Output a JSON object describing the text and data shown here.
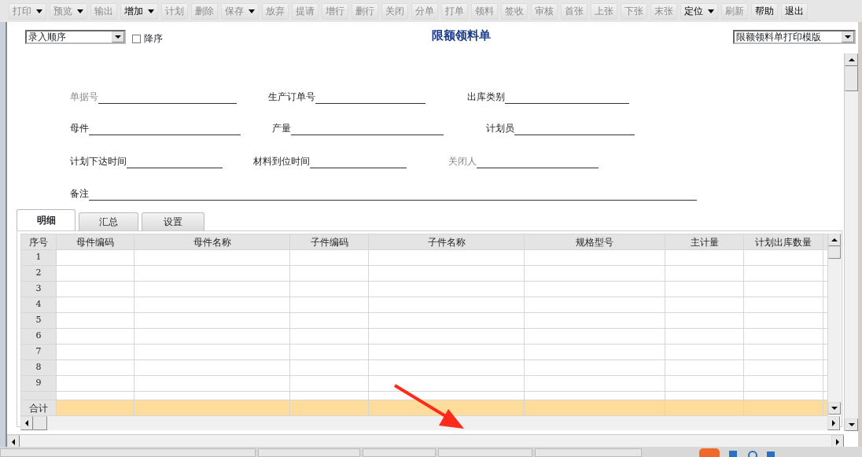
{
  "toolbar": [
    {
      "label": "打印",
      "enabled": false,
      "dropdown": true
    },
    {
      "label": "预览",
      "enabled": false,
      "dropdown": true
    },
    {
      "label": "输出",
      "enabled": false,
      "dropdown": false
    },
    {
      "label": "增加",
      "enabled": true,
      "dropdown": true
    },
    {
      "label": "计划",
      "enabled": false,
      "dropdown": false
    },
    {
      "label": "删除",
      "enabled": false,
      "dropdown": false
    },
    {
      "label": "保存",
      "enabled": false,
      "dropdown": true
    },
    {
      "label": "放弃",
      "enabled": false,
      "dropdown": false
    },
    {
      "label": "提请",
      "enabled": false,
      "dropdown": false
    },
    {
      "label": "增行",
      "enabled": false,
      "dropdown": false
    },
    {
      "label": "删行",
      "enabled": false,
      "dropdown": false
    },
    {
      "label": "关闭",
      "enabled": false,
      "dropdown": false
    },
    {
      "label": "分单",
      "enabled": false,
      "dropdown": false
    },
    {
      "label": "打单",
      "enabled": false,
      "dropdown": false
    },
    {
      "label": "领料",
      "enabled": false,
      "dropdown": false
    },
    {
      "label": "签收",
      "enabled": false,
      "dropdown": false
    },
    {
      "label": "审核",
      "enabled": false,
      "dropdown": false
    },
    {
      "label": "首张",
      "enabled": false,
      "dropdown": false
    },
    {
      "label": "上张",
      "enabled": false,
      "dropdown": false
    },
    {
      "label": "下张",
      "enabled": false,
      "dropdown": false
    },
    {
      "label": "末张",
      "enabled": false,
      "dropdown": false
    },
    {
      "label": "定位",
      "enabled": true,
      "dropdown": true
    },
    {
      "label": "刷新",
      "enabled": false,
      "dropdown": false
    },
    {
      "label": "帮助",
      "enabled": true,
      "dropdown": false
    },
    {
      "label": "退出",
      "enabled": true,
      "dropdown": false
    }
  ],
  "sort_select": {
    "value": "录入顺序"
  },
  "descending": {
    "label": "降序",
    "checked": false
  },
  "title": "限额领料单",
  "template_select": {
    "value": "限额领料单打印模版"
  },
  "form_rows": [
    [
      {
        "label": "单据号",
        "disabled": true
      },
      {
        "label": "生产订单号",
        "disabled": false
      },
      {
        "label": "出库类别",
        "disabled": false
      }
    ],
    [
      {
        "label": "母件",
        "disabled": false
      },
      {
        "label": "产量",
        "disabled": false
      },
      {
        "label": "计划员",
        "disabled": false
      }
    ],
    [
      {
        "label": "计划下达时间",
        "disabled": false
      },
      {
        "label": "材料到位时间",
        "disabled": false
      },
      {
        "label": "关闭人",
        "disabled": true
      }
    ],
    [
      {
        "label": "备注",
        "disabled": false
      }
    ]
  ],
  "tabs": [
    {
      "label": "明细",
      "selected": true
    },
    {
      "label": "汇总",
      "selected": false
    },
    {
      "label": "设置",
      "selected": false
    }
  ],
  "table": {
    "columns": [
      "序号",
      "母件编码",
      "母件名称",
      "子件编码",
      "子件名称",
      "规格型号",
      "主计量",
      "计划出库数量"
    ],
    "rows": [
      "1",
      "2",
      "3",
      "4",
      "5",
      "6",
      "7",
      "8",
      "9"
    ],
    "total_label": "合计"
  }
}
